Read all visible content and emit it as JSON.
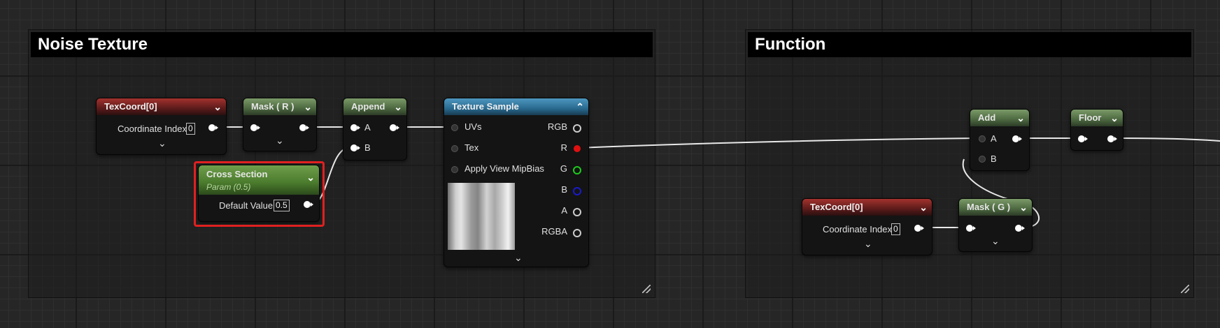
{
  "comments": {
    "noise_title": "Noise Texture",
    "function_title": "Function"
  },
  "nodes": {
    "texcoord1": {
      "title": "TexCoord[0]",
      "label": "Coordinate Index",
      "value": "0"
    },
    "mask_r": {
      "title": "Mask ( R )"
    },
    "append": {
      "title": "Append",
      "pin_a": "A",
      "pin_b": "B"
    },
    "cross_section": {
      "title": "Cross Section",
      "subtitle": "Param (0.5)",
      "label": "Default Value",
      "value": "0.5"
    },
    "texture_sample": {
      "title": "Texture Sample",
      "in_uvs": "UVs",
      "in_tex": "Tex",
      "in_mip": "Apply View MipBias",
      "out_rgb": "RGB",
      "out_r": "R",
      "out_g": "G",
      "out_b": "B",
      "out_a": "A",
      "out_rgba": "RGBA"
    },
    "add": {
      "title": "Add",
      "pin_a": "A",
      "pin_b": "B"
    },
    "floor": {
      "title": "Floor"
    },
    "texcoord2": {
      "title": "TexCoord[0]",
      "label": "Coordinate Index",
      "value": "0"
    },
    "mask_g": {
      "title": "Mask ( G )"
    }
  },
  "colors": {
    "selection": "#e02020",
    "wire": "#e8e8e8",
    "pin_r": "#e01010",
    "pin_g": "#1ecb1e",
    "pin_b": "#1a1acc"
  },
  "icons": {
    "chevron": "chevron-down-icon",
    "collapse": "chevron-up-icon",
    "resize": "resize-handle-icon"
  }
}
